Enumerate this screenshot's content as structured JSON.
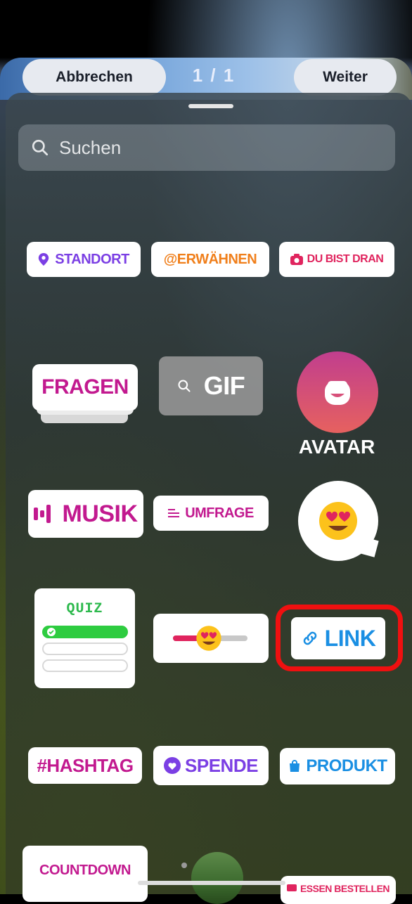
{
  "header": {
    "cancel_label": "Abbrechen",
    "page_counter": "1 / 1",
    "next_label": "Weiter"
  },
  "search": {
    "placeholder": "Suchen"
  },
  "stickers": {
    "standort": "STANDORT",
    "erwaehnen": "@ERWÄHNEN",
    "du_bist_dran": "DU BIST DRAN",
    "fragen": "FRAGEN",
    "gif": "GIF",
    "avatar": "AVATAR",
    "musik": "MUSIK",
    "umfrage": "UMFRAGE",
    "quiz": "QUIZ",
    "link": "LINK",
    "hashtag": "#HASHTAG",
    "spende": "SPENDE",
    "produkt": "PRODUKT",
    "countdown": "COUNTDOWN",
    "essen_bestellen": "ESSEN BESTELLEN"
  },
  "colors": {
    "highlight": "#ef1010",
    "purple": "#7b3fe4",
    "magenta": "#c2198f",
    "orange": "#f07f1b",
    "blue": "#1a8fe3",
    "pink": "#e0245e"
  }
}
